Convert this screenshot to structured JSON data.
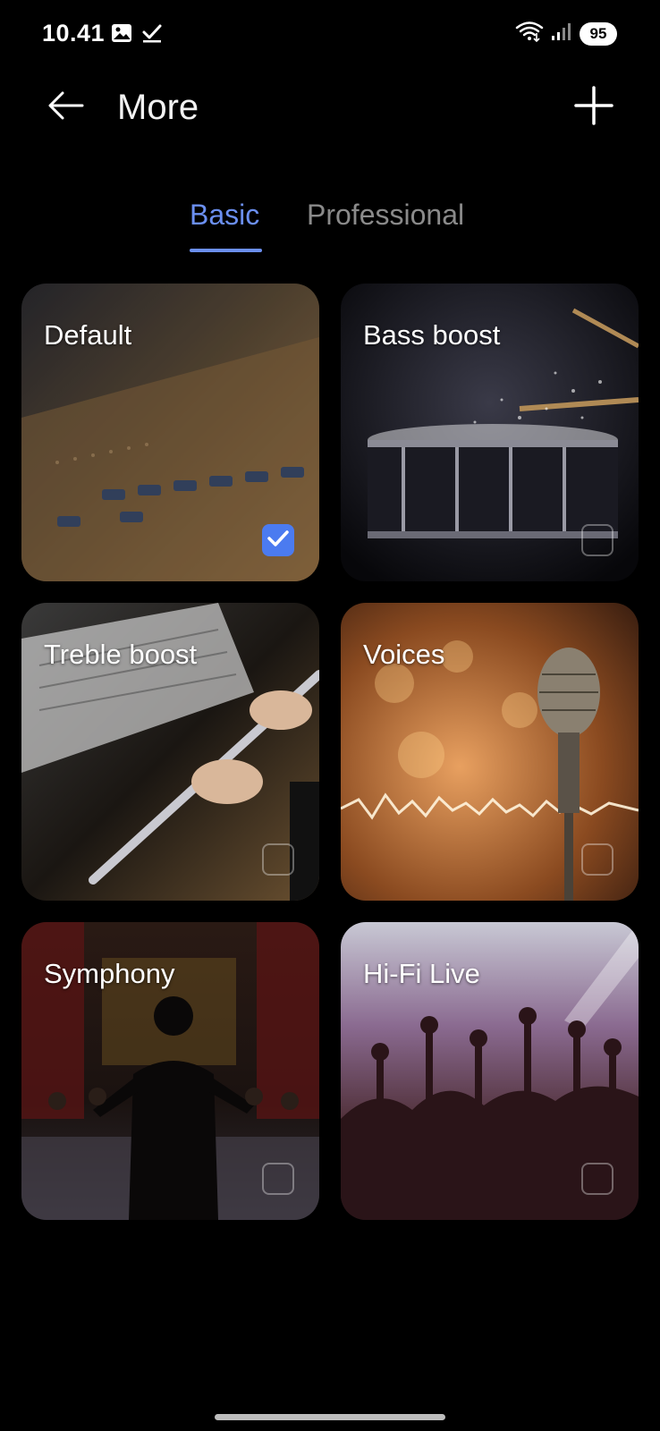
{
  "status_bar": {
    "time": "10.41",
    "battery": "95",
    "left_icons": [
      "image-icon",
      "check-icon"
    ],
    "right_icons": [
      "wifi-icon",
      "signal-icon"
    ]
  },
  "header": {
    "title": "More",
    "back_icon": "back-arrow-icon",
    "add_icon": "plus-icon"
  },
  "tabs": [
    {
      "label": "Basic",
      "active": true
    },
    {
      "label": "Professional",
      "active": false
    }
  ],
  "cards": [
    {
      "label": "Default",
      "checked": true
    },
    {
      "label": "Bass boost",
      "checked": false
    },
    {
      "label": "Treble boost",
      "checked": false
    },
    {
      "label": "Voices",
      "checked": false
    },
    {
      "label": "Symphony",
      "checked": false
    },
    {
      "label": "Hi-Fi Live",
      "checked": false
    }
  ],
  "colors": {
    "accent": "#6b8ff0",
    "checkbox_checked": "#4b7bf0",
    "background": "#000000"
  }
}
